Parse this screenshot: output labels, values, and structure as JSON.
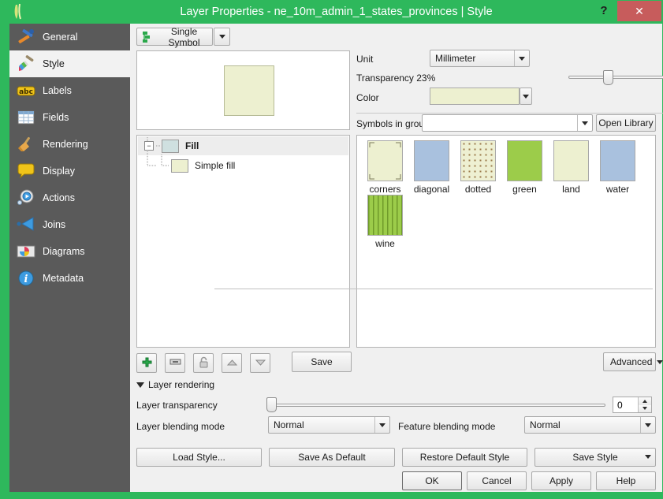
{
  "window": {
    "title": "Layer Properties - ne_10m_admin_1_states_provinces | Style",
    "help_label": "?",
    "close_label": "✕",
    "app_icon": "qgis-logo-icon",
    "frame_color": "#2eb85c",
    "titlebar_color": "#2eb85c",
    "close_color": "#c75c5c"
  },
  "sidebar": {
    "items": [
      {
        "label": "General",
        "icon": "hammer-wrench-icon",
        "active": false
      },
      {
        "label": "Style",
        "icon": "paintbrush-icon",
        "active": true
      },
      {
        "label": "Labels",
        "icon": "abc-label-icon",
        "active": false
      },
      {
        "label": "Fields",
        "icon": "table-grid-icon",
        "active": false
      },
      {
        "label": "Rendering",
        "icon": "broom-icon",
        "active": false
      },
      {
        "label": "Display",
        "icon": "speech-bubble-icon",
        "active": false
      },
      {
        "label": "Actions",
        "icon": "gear-play-icon",
        "active": false
      },
      {
        "label": "Joins",
        "icon": "join-arrow-icon",
        "active": false
      },
      {
        "label": "Diagrams",
        "icon": "pie-chart-icon",
        "active": false
      },
      {
        "label": "Metadata",
        "icon": "info-circle-icon",
        "active": false
      }
    ]
  },
  "renderer": {
    "selected": "Single Symbol",
    "icon": "single-symbol-icon"
  },
  "preview": {
    "fill_color": "#edf0d0",
    "border_color": "#b6bb96"
  },
  "symbol_tree": {
    "root": {
      "label": "Fill",
      "swatch_color": "#cfe0e0"
    },
    "child": {
      "label": "Simple fill",
      "swatch_color": "#edf0d0"
    }
  },
  "symbol_toolbar": {
    "add_label": "+",
    "remove_label": "−",
    "lock_label": "lock",
    "up_label": "▲",
    "down_label": "▼",
    "save_label": "Save"
  },
  "properties": {
    "unit_label": "Unit",
    "unit_value": "Millimeter",
    "transparency_label": "Transparency 23%",
    "transparency_percent": 23,
    "color_label": "Color",
    "color_value": "#edf0d0",
    "symbols_in_group_label": "Symbols in group",
    "symbols_in_group_value": "",
    "open_library_label": "Open Library"
  },
  "symbol_library": {
    "items": [
      {
        "label": "corners",
        "fill": "#edf0d0",
        "pattern": "corners"
      },
      {
        "label": "diagonal",
        "fill": "#a9c1de",
        "pattern": "solid"
      },
      {
        "label": "dotted",
        "fill": "#eef0d2",
        "pattern": "dotted"
      },
      {
        "label": "green",
        "fill": "#9ccc4a",
        "pattern": "solid"
      },
      {
        "label": "land",
        "fill": "#edf0d0",
        "pattern": "solid"
      },
      {
        "label": "water",
        "fill": "#a9c1de",
        "pattern": "solid"
      },
      {
        "label": "wine",
        "fill": "#9ccc4a",
        "pattern": "dashes"
      }
    ]
  },
  "advanced": {
    "label": "Advanced"
  },
  "layer_rendering": {
    "group_label": "Layer rendering",
    "transparency_label": "Layer transparency",
    "transparency_value": "0",
    "layer_blending_label": "Layer blending mode",
    "layer_blending_value": "Normal",
    "feature_blending_label": "Feature blending mode",
    "feature_blending_value": "Normal"
  },
  "footer": {
    "load_style": "Load Style...",
    "save_as_default": "Save As Default",
    "restore_default_style": "Restore Default Style",
    "save_style": "Save Style",
    "ok": "OK",
    "cancel": "Cancel",
    "apply": "Apply",
    "help": "Help"
  }
}
